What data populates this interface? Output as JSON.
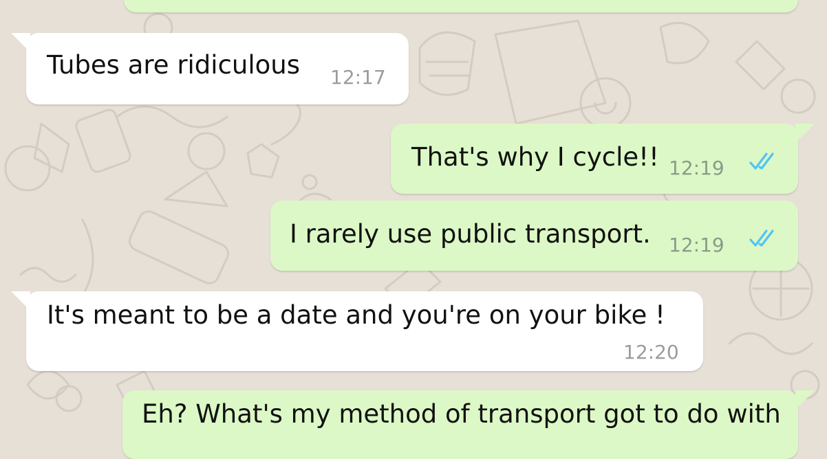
{
  "messages": [
    {
      "id": "m0",
      "direction": "outgoing",
      "text": "",
      "time": ""
    },
    {
      "id": "m1",
      "direction": "incoming",
      "text": "Tubes are ridiculous",
      "time": "12:17"
    },
    {
      "id": "m2",
      "direction": "outgoing",
      "text": "That's why I cycle!!",
      "time": "12:19",
      "status": "read"
    },
    {
      "id": "m3",
      "direction": "outgoing",
      "text": "I rarely use public transport.",
      "time": "12:19",
      "status": "read"
    },
    {
      "id": "m4",
      "direction": "incoming",
      "text": "It's meant to be a date and you're on your bike !",
      "time": "12:20"
    },
    {
      "id": "m5",
      "direction": "outgoing",
      "text": "Eh? What's my method of transport got to do with",
      "time": ""
    }
  ],
  "icons": {
    "read_ticks": "double-check-icon"
  },
  "colors": {
    "wallpaper": "#e6e0d7",
    "incoming_bubble": "#ffffff",
    "outgoing_bubble": "#dcf8c6",
    "read_tick": "#4fc3f7"
  }
}
